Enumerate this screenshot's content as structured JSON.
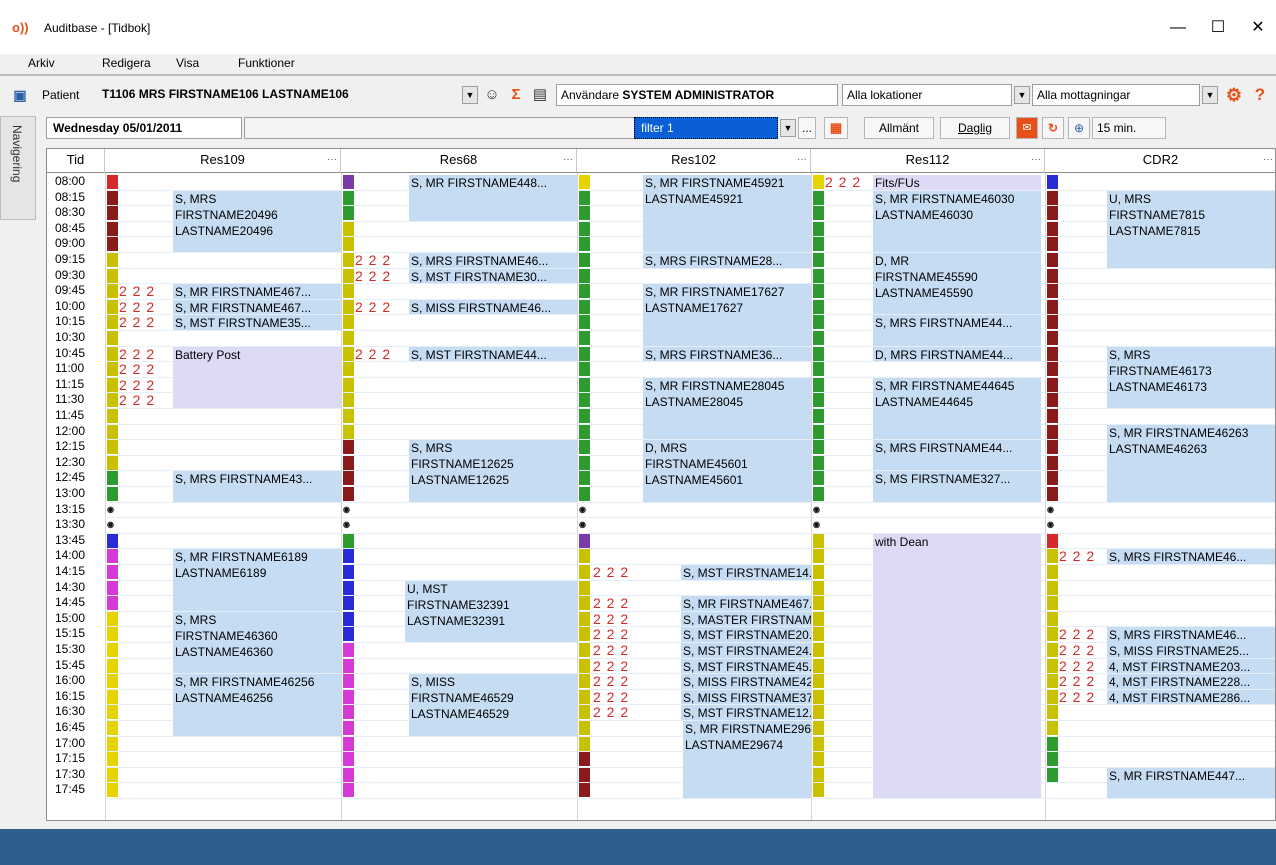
{
  "window": {
    "title": "Auditbase - [Tidbok]"
  },
  "menu": [
    "Arkiv",
    "Redigera",
    "Visa",
    "Funktioner"
  ],
  "patient_bar": {
    "label": "Patient",
    "patient": "T1106 MRS FIRSTNAME106 LASTNAME106",
    "user_prefix": "Användare",
    "user": "SYSTEM ADMINISTRATOR",
    "location": "Alla lokationer",
    "reception": "Alla mottagningar"
  },
  "date_bar": {
    "date": "Wednesday 05/01/2011",
    "filter": "filter 1",
    "filter_more": "...",
    "btn_general": "Allmänt",
    "btn_daily": "Daglig",
    "zoom": "15 min."
  },
  "sidebar": {
    "tab": "Navigering"
  },
  "columns": [
    {
      "label": "Tid"
    },
    {
      "label": "Res109"
    },
    {
      "label": "Res68"
    },
    {
      "label": "Res102"
    },
    {
      "label": "Res112"
    },
    {
      "label": "CDR2"
    }
  ],
  "times": [
    "08:00",
    "08:15",
    "08:30",
    "08:45",
    "09:00",
    "09:15",
    "09:30",
    "09:45",
    "10:00",
    "10:15",
    "10:30",
    "10:45",
    "11:00",
    "11:15",
    "11:30",
    "11:45",
    "12:00",
    "12:15",
    "12:30",
    "12:45",
    "13:00",
    "13:15",
    "13:30",
    "13:45",
    "14:00",
    "14:15",
    "14:30",
    "14:45",
    "15:00",
    "15:15",
    "15:30",
    "15:45",
    "16:00",
    "16:15",
    "16:30",
    "16:45",
    "17:00",
    "17:15",
    "17:30",
    "17:45"
  ],
  "appointments": [
    {
      "lines": [
        "S, MRS",
        "FIRSTNAME20496",
        "LASTNAME20496"
      ]
    },
    {
      "lines": [
        "S, MR FIRSTNAME467..."
      ]
    },
    {
      "lines": [
        "S, MR FIRSTNAME467..."
      ]
    },
    {
      "lines": [
        "S, MST FIRSTNAME35..."
      ]
    },
    {
      "lines": [
        "Battery Post"
      ]
    },
    {
      "lines": [
        "S, MRS FIRSTNAME43..."
      ]
    },
    {
      "lines": [
        "S, MR FIRSTNAME6189",
        "LASTNAME6189"
      ]
    },
    {
      "lines": [
        "S, MRS",
        "FIRSTNAME46360",
        "LASTNAME46360"
      ]
    },
    {
      "lines": [
        "S, MR FIRSTNAME46256",
        "LASTNAME46256"
      ]
    },
    {
      "lines": [
        "S, MR FIRSTNAME448..."
      ]
    },
    {
      "lines": [
        "S, MRS FIRSTNAME46..."
      ]
    },
    {
      "lines": [
        "S, MST FIRSTNAME30..."
      ]
    },
    {
      "lines": [
        "S, MISS FIRSTNAME46..."
      ]
    },
    {
      "lines": [
        "S, MST FIRSTNAME44..."
      ]
    },
    {
      "lines": [
        "S, MRS",
        "FIRSTNAME12625",
        "LASTNAME12625"
      ]
    },
    {
      "lines": [
        "U, MST",
        "FIRSTNAME32391",
        "LASTNAME32391"
      ]
    },
    {
      "lines": [
        "S, MISS",
        "FIRSTNAME46529",
        "LASTNAME46529"
      ]
    },
    {
      "lines": [
        "S, MR FIRSTNAME45921",
        "LASTNAME45921"
      ]
    },
    {
      "lines": [
        "S, MRS FIRSTNAME28..."
      ]
    },
    {
      "lines": [
        "S, MR FIRSTNAME17627",
        "LASTNAME17627"
      ]
    },
    {
      "lines": [
        "S, MRS FIRSTNAME36..."
      ]
    },
    {
      "lines": [
        "S, MR FIRSTNAME28045",
        "LASTNAME28045"
      ]
    },
    {
      "lines": [
        "D, MRS",
        "FIRSTNAME45601",
        "LASTNAME45601"
      ]
    },
    {
      "lines": [
        "S, MST FIRSTNAME14..."
      ]
    },
    {
      "lines": [
        "S, MR FIRSTNAME467..."
      ]
    },
    {
      "lines": [
        "S, MASTER FIRSTNAM..."
      ]
    },
    {
      "lines": [
        "S, MST FIRSTNAME20..."
      ]
    },
    {
      "lines": [
        "S, MST FIRSTNAME24..."
      ]
    },
    {
      "lines": [
        "S, MST FIRSTNAME45..."
      ]
    },
    {
      "lines": [
        "S, MISS FIRSTNAME42..."
      ]
    },
    {
      "lines": [
        "S, MISS FIRSTNAME37..."
      ]
    },
    {
      "lines": [
        "S, MST FIRSTNAME12..."
      ]
    },
    {
      "lines": [
        "S, MR FIRSTNAME29674",
        "LASTNAME29674"
      ]
    },
    {
      "lines": [
        "Fits/FUs"
      ]
    },
    {
      "lines": [
        "S, MR FIRSTNAME46030",
        "LASTNAME46030"
      ]
    },
    {
      "lines": [
        "D, MR",
        "FIRSTNAME45590",
        "LASTNAME45590"
      ]
    },
    {
      "lines": [
        "S, MRS FIRSTNAME44..."
      ]
    },
    {
      "lines": [
        "D, MRS FIRSTNAME44..."
      ]
    },
    {
      "lines": [
        "S, MR FIRSTNAME44645",
        "LASTNAME44645"
      ]
    },
    {
      "lines": [
        "S, MRS FIRSTNAME44..."
      ]
    },
    {
      "lines": [
        "S, MS FIRSTNAME327..."
      ]
    },
    {
      "lines": [
        "with Dean"
      ]
    },
    {
      "lines": [
        "U, MRS",
        "FIRSTNAME7815",
        "LASTNAME7815"
      ]
    },
    {
      "lines": [
        "S, MRS",
        "FIRSTNAME46173",
        "LASTNAME46173"
      ]
    },
    {
      "lines": [
        "S, MR FIRSTNAME46263",
        "LASTNAME46263"
      ]
    },
    {
      "lines": [
        "S, MRS FIRSTNAME46..."
      ]
    },
    {
      "lines": [
        "S, MRS FIRSTNAME46..."
      ]
    },
    {
      "lines": [
        "S, MISS FIRSTNAME25..."
      ]
    },
    {
      "lines": [
        "4, MST FIRSTNAME203..."
      ]
    },
    {
      "lines": [
        "4, MST FIRSTNAME228..."
      ]
    },
    {
      "lines": [
        "4, MST FIRSTNAME286..."
      ]
    },
    {
      "lines": [
        "S, MR FIRSTNAME447..."
      ]
    }
  ],
  "colors": {
    "accent": "#2e5f8c",
    "appt": "#c5dcf3",
    "lavender": "#dcdaf5",
    "orange": "#e8501a"
  }
}
